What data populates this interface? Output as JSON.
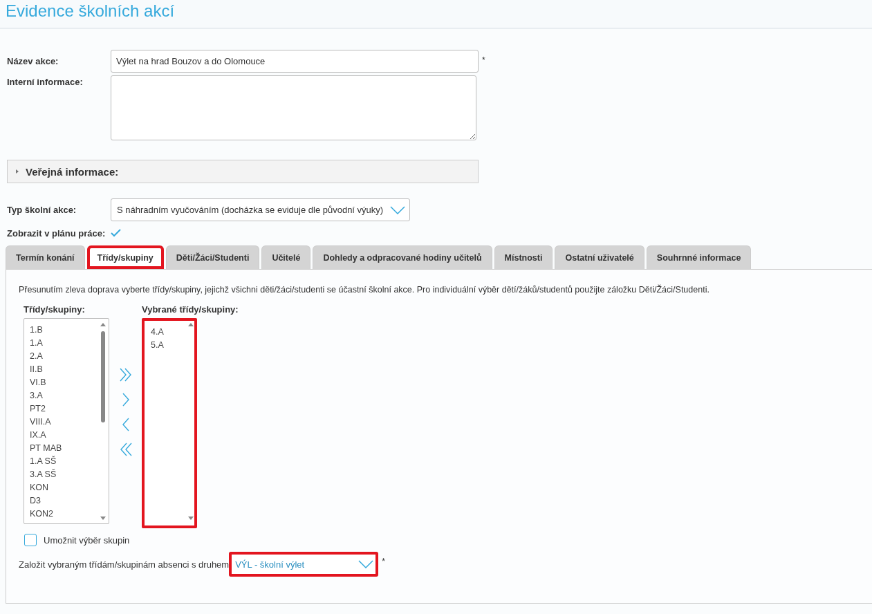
{
  "title": "Evidence školních akcí",
  "name_field": {
    "label": "Název akce:",
    "value": "Výlet na hrad Bouzov a do Olomouce",
    "required": "*"
  },
  "internal_field": {
    "label": "Interní informace:"
  },
  "public_info": {
    "label": "Veřejná informace:",
    "expanded": false
  },
  "event_type": {
    "label": "Typ školní akce:",
    "value": "S náhradním vyučováním (docházka se eviduje dle původní výuky)"
  },
  "show_in_plan": {
    "label": "Zobrazit v plánu práce:",
    "checked": true
  },
  "tabs": [
    {
      "label": "Termín konání",
      "selected": false,
      "highlighted": false
    },
    {
      "label": "Třídy/skupiny",
      "selected": true,
      "highlighted": true
    },
    {
      "label": "Děti/Žáci/Studenti",
      "selected": false,
      "highlighted": false
    },
    {
      "label": "Učitelé",
      "selected": false,
      "highlighted": false
    },
    {
      "label": "Dohledy a odpracované hodiny učitelů",
      "selected": false,
      "highlighted": false
    },
    {
      "label": "Místnosti",
      "selected": false,
      "highlighted": false
    },
    {
      "label": "Ostatní uživatelé",
      "selected": false,
      "highlighted": false
    },
    {
      "label": "Souhrnné informace",
      "selected": false,
      "highlighted": false
    }
  ],
  "description": "Přesunutím zleva doprava vyberte třídy/skupiny, jejichž všichni děti/žáci/studenti se účastní školní akce. Pro individuální výběr dětí/žáků/studentů použijte záložku Děti/Žáci/Studenti.",
  "available": {
    "label": "Třídy/skupiny:",
    "highlighted": false,
    "items": [
      "1.B",
      "1.A",
      "2.A",
      "II.B",
      "VI.B",
      "3.A",
      "PT2",
      "VIII.A",
      "IX.A",
      "PT MAB",
      "1.A SŠ",
      "3.A SŠ",
      "KON",
      "D3",
      "KON2"
    ]
  },
  "chosen": {
    "label": "Vybrané třídy/skupiny:",
    "highlighted": true,
    "items": [
      "4.A",
      "5.A"
    ]
  },
  "allow_groups": {
    "label": "Umožnit výběr skupin",
    "checked": false
  },
  "absence": {
    "label": "Založit vybraným třídám/skupinám absenci s druhem",
    "value": "VÝL - školní výlet",
    "required": "*",
    "highlighted": true
  }
}
